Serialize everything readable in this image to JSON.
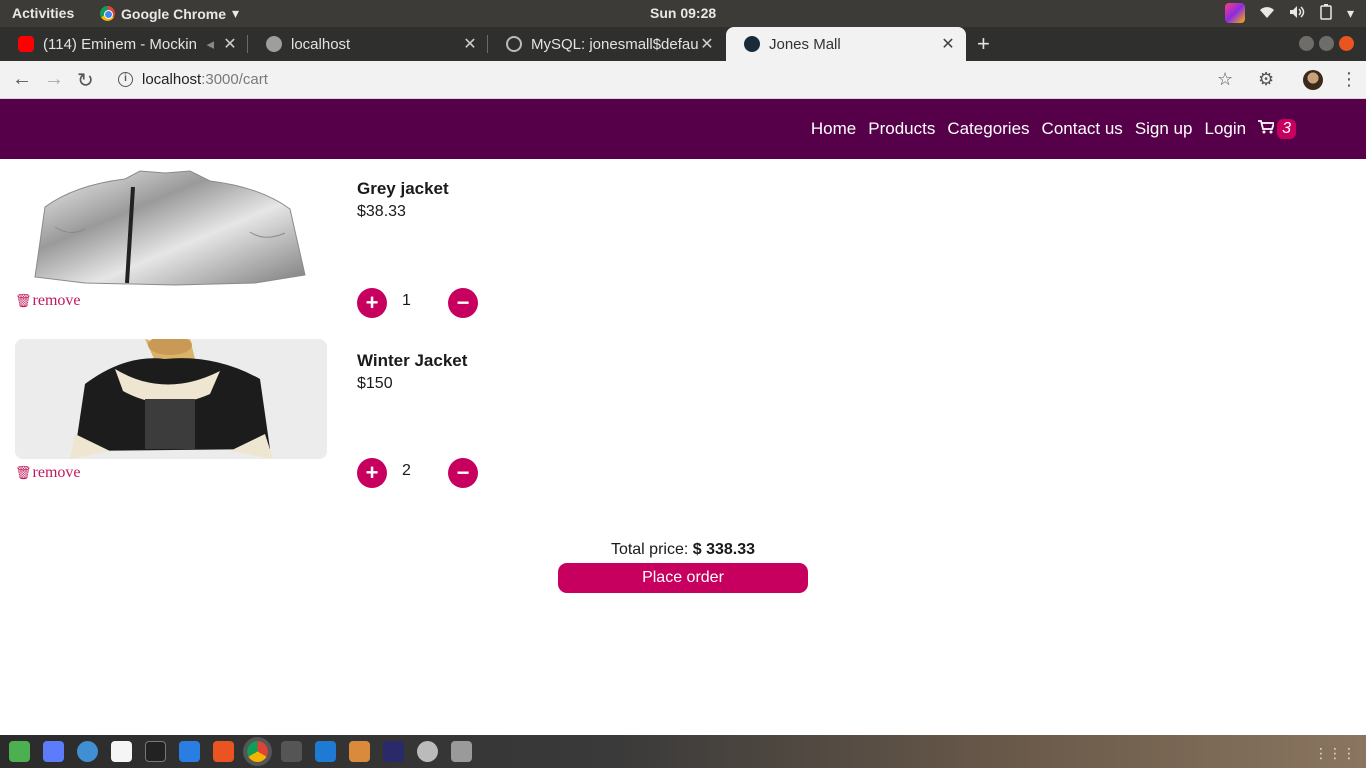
{
  "system": {
    "activities": "Activities",
    "app_name": "Google Chrome",
    "clock": "Sun 09:28"
  },
  "tabs": [
    {
      "title": "(114) Eminem - Mockin",
      "favicon": "youtube-icon",
      "color": "#ff0000"
    },
    {
      "title": "localhost",
      "favicon": "globe-icon",
      "color": "#9e9e9e"
    },
    {
      "title": "MySQL: jonesmall$default",
      "favicon": "mysql-icon",
      "color": "#444444"
    },
    {
      "title": "Jones Mall",
      "favicon": "react-icon",
      "color": "#1e88e5",
      "active": true
    }
  ],
  "address": {
    "host": "localhost",
    "path": ":3000/cart"
  },
  "nav": {
    "links": [
      "Home",
      "Products",
      "Categories",
      "Contact us",
      "Sign up",
      "Login"
    ],
    "cart_count": "3"
  },
  "cart": {
    "items": [
      {
        "name": "Grey jacket",
        "price": "$38.33",
        "quantity": "1",
        "remove_label": "remove"
      },
      {
        "name": "Winter Jacket",
        "price": "$150",
        "quantity": "2",
        "remove_label": "remove"
      }
    ],
    "total_label": "Total price:",
    "total_value": "$ 338.33",
    "order_label": "Place order"
  },
  "colors": {
    "navbar": "#56004a",
    "accent": "#c7005f"
  }
}
